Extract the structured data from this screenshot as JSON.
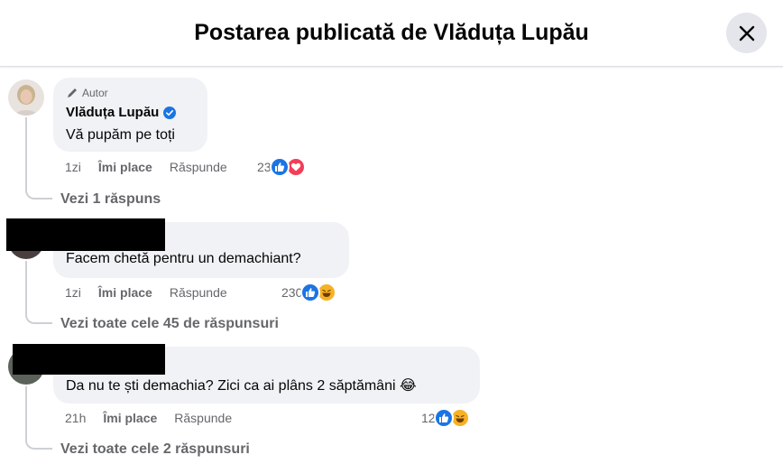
{
  "header": {
    "title": "Postarea publicată de Vlăduța Lupău",
    "close_icon": "close-icon"
  },
  "comments": [
    {
      "author_tag": "Autor",
      "author_name": "Vlăduța Lupău",
      "verified": true,
      "text": "Vă pupăm pe toți",
      "time": "1zi",
      "like_label": "Îmi place",
      "reply_label": "Răspunde",
      "reaction_count": "23",
      "reactions": [
        "like-icon",
        "love-icon"
      ],
      "view_replies": "Vezi 1 răspuns"
    },
    {
      "text": "Facem chetă pentru un demachiant?",
      "time": "1zi",
      "like_label": "Îmi place",
      "reply_label": "Răspunde",
      "reaction_count": "230",
      "reactions": [
        "like-icon",
        "haha-icon"
      ],
      "view_replies": "Vezi toate cele 45 de răspunsuri"
    },
    {
      "text": "Da nu te ști demachia? Zici ca ai plâns 2 săptămâni 😂",
      "time": "21h",
      "like_label": "Îmi place",
      "reply_label": "Răspunde",
      "reaction_count": "12",
      "reactions": [
        "like-icon",
        "haha-icon"
      ],
      "view_replies": "Vezi toate cele 2 răspunsuri"
    }
  ],
  "colors": {
    "like": "#1b74e4",
    "love": "#f33e58",
    "haha": "#f7b125",
    "bubble": "#f0f2f5",
    "secondary_text": "#65676b"
  }
}
